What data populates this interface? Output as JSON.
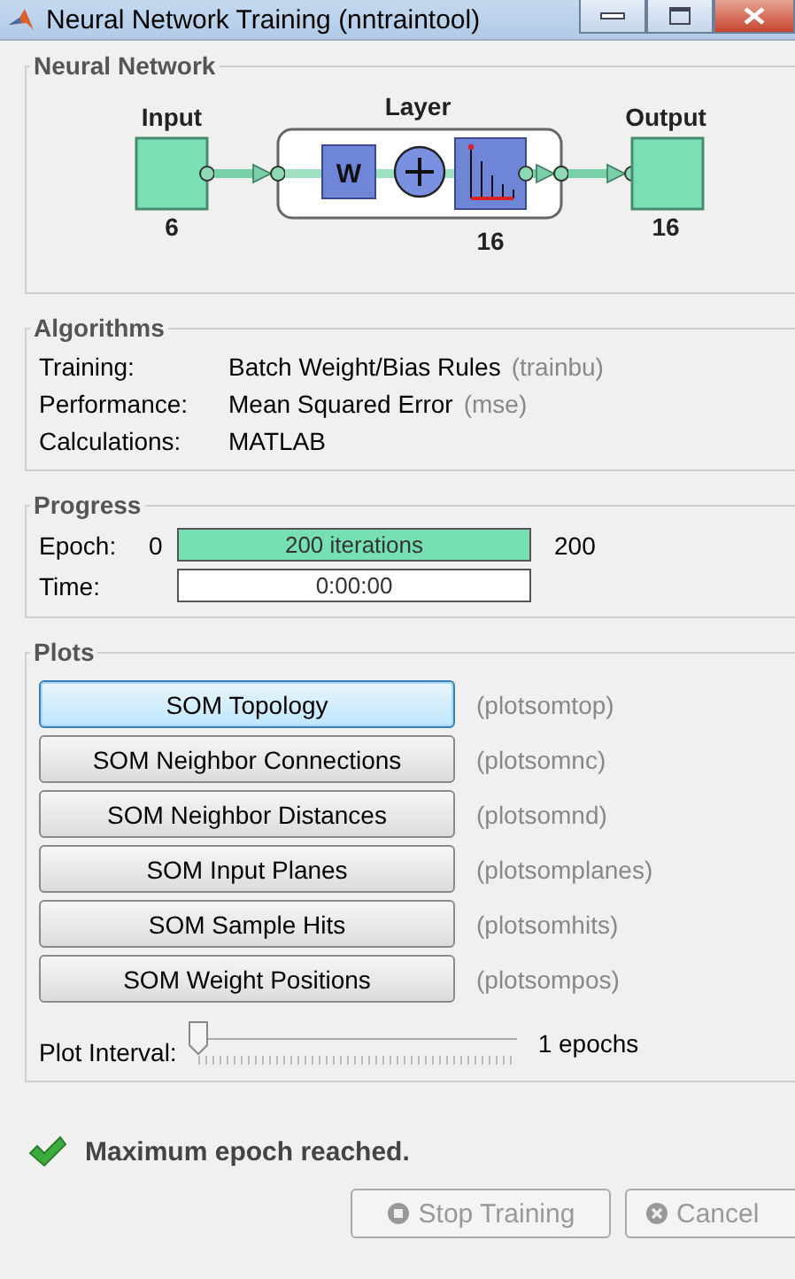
{
  "window": {
    "title": "Neural Network Training (nntraintool)"
  },
  "network": {
    "title": "Neural Network",
    "input": {
      "label": "Input",
      "size": "6"
    },
    "layer": {
      "label": "Layer",
      "size": "16",
      "weight_symbol": "W"
    },
    "output": {
      "label": "Output",
      "size": "16"
    }
  },
  "algorithms": {
    "title": "Algorithms",
    "rows": [
      {
        "label": "Training:",
        "value": "Batch Weight/Bias Rules",
        "code": "(trainbu)"
      },
      {
        "label": "Performance:",
        "value": "Mean Squared Error",
        "code": "(mse)"
      },
      {
        "label": "Calculations:",
        "value": "MATLAB"
      }
    ]
  },
  "progress": {
    "title": "Progress",
    "rows": [
      {
        "label": "Epoch:",
        "start": "0",
        "bar_text": "200 iterations",
        "level": 1,
        "end": "200"
      },
      {
        "label": "Time:",
        "bar_text": "0:00:00"
      }
    ]
  },
  "plots": {
    "title": "Plots",
    "buttons": [
      {
        "label": "SOM Topology",
        "code": "(plotsomtop)",
        "focused": true
      },
      {
        "label": "SOM Neighbor Connections",
        "code": "(plotsomnc)",
        "focused": false
      },
      {
        "label": "SOM Neighbor Distances",
        "code": "(plotsomnd)",
        "focused": false
      },
      {
        "label": "SOM Input Planes",
        "code": "(plotsomplanes)",
        "focused": false
      },
      {
        "label": "SOM Sample Hits",
        "code": "(plotsomhits)",
        "focused": false
      },
      {
        "label": "SOM Weight Positions",
        "code": "(plotsompos)",
        "focused": false
      }
    ],
    "interval": {
      "label": "Plot Interval:",
      "level": 0,
      "reading": "1 epochs"
    }
  },
  "status": {
    "text": "Maximum epoch reached."
  },
  "buttons": [
    {
      "label": "Stop Training",
      "kind": "stop",
      "disabled": true
    },
    {
      "label": "Cancel",
      "kind": "cancel",
      "disabled": true
    }
  ]
}
